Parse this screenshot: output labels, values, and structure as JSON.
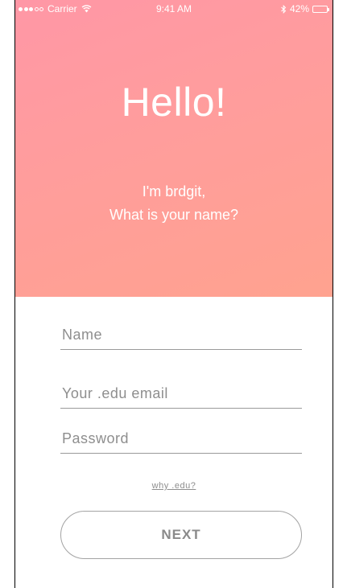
{
  "status_bar": {
    "carrier": "Carrier",
    "time": "9:41 AM",
    "battery_label": "42%",
    "battery_level": 0.42,
    "signal_bars_on": 3,
    "signal_bars_total": 5
  },
  "header": {
    "title": "Hello!",
    "subtitle_line1": "I'm brdgit,",
    "subtitle_line2": "What is your name?"
  },
  "form": {
    "name_placeholder": "Name",
    "name_value": "",
    "email_placeholder": "Your .edu email",
    "email_value": "",
    "password_placeholder": "Password",
    "password_value": ""
  },
  "links": {
    "why_edu": "why .edu?"
  },
  "actions": {
    "next_label": "NEXT"
  },
  "colors": {
    "hero_gradient_start": "#ff97a6",
    "hero_gradient_end": "#ffa28f",
    "button_border": "#a3a3a3",
    "text_muted": "#8e8e8e"
  }
}
